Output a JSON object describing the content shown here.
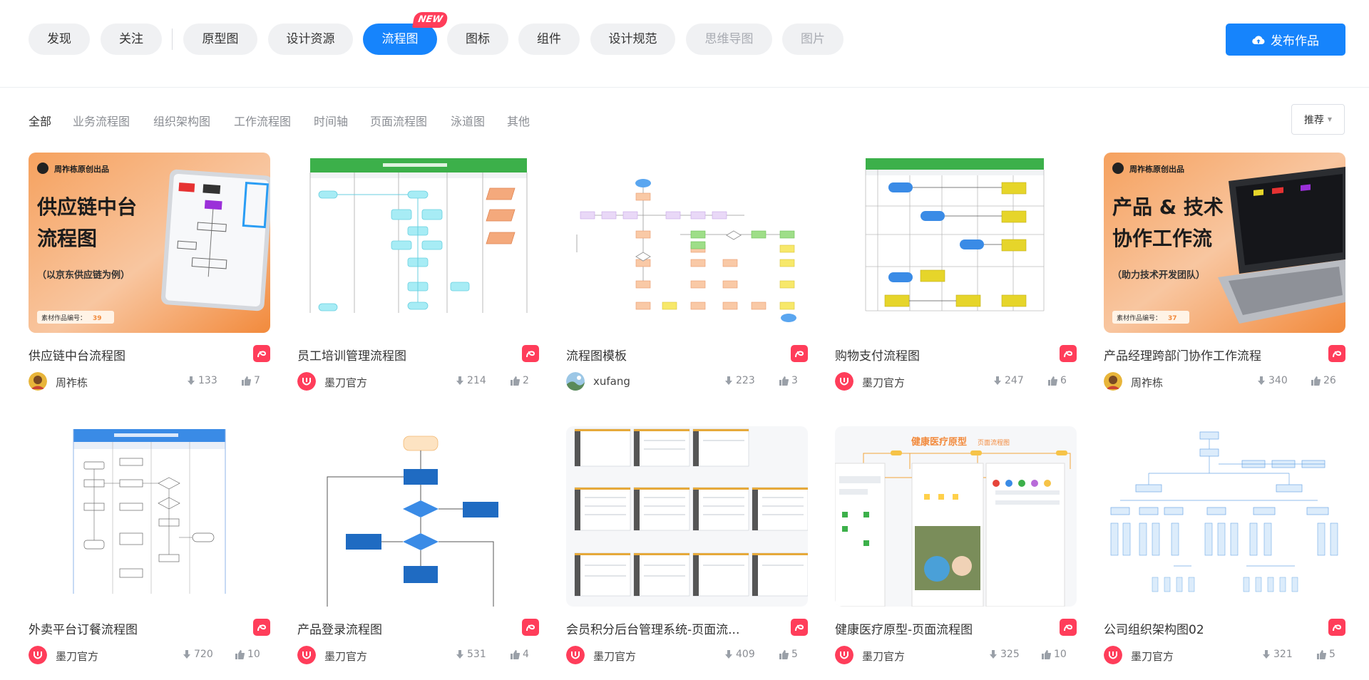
{
  "nav": {
    "pills": [
      "发现",
      "关注",
      "原型图",
      "设计资源",
      "流程图",
      "图标",
      "组件",
      "设计规范",
      "思维导图",
      "图片"
    ],
    "new_badge": "NEW",
    "publish_label": "发布作品"
  },
  "filters": [
    "全部",
    "业务流程图",
    "组织架构图",
    "工作流程图",
    "时间轴",
    "页面流程图",
    "泳道图",
    "其他"
  ],
  "sort_label": "推荐",
  "cards": [
    {
      "title": "供应链中台流程图",
      "author": "周祚栋",
      "downloads": "133",
      "likes": "7",
      "thumb": {
        "brand": "周祚栋原创出品",
        "line1": "供应链中台",
        "line2": "流程图",
        "sub": "（以京东供应链为例）",
        "code_label": "素材作品编号：",
        "code": "39"
      }
    },
    {
      "title": "员工培训管理流程图",
      "author": "墨刀官方",
      "downloads": "214",
      "likes": "2"
    },
    {
      "title": "流程图模板",
      "author": "xufang",
      "downloads": "223",
      "likes": "3"
    },
    {
      "title": "购物支付流程图",
      "author": "墨刀官方",
      "downloads": "247",
      "likes": "6"
    },
    {
      "title": "产品经理跨部门协作工作流程",
      "author": "周祚栋",
      "downloads": "340",
      "likes": "26",
      "thumb": {
        "brand": "周祚栋原创出品",
        "line1": "产品 & 技术",
        "line2": "协作工作流",
        "sub": "（助力技术开发团队）",
        "code_label": "素材作品编号：",
        "code": "37"
      }
    },
    {
      "title": "外卖平台订餐流程图",
      "author": "墨刀官方",
      "downloads": "720",
      "likes": "10"
    },
    {
      "title": "产品登录流程图",
      "author": "墨刀官方",
      "downloads": "531",
      "likes": "4"
    },
    {
      "title": "会员积分后台管理系统-页面流...",
      "author": "墨刀官方",
      "downloads": "409",
      "likes": "5"
    },
    {
      "title": "健康医疗原型-页面流程图",
      "author": "墨刀官方",
      "downloads": "325",
      "likes": "10",
      "thumb": {
        "heading": "健康医疗原型",
        "tag": "页面流程图"
      }
    },
    {
      "title": "公司组织架构图02",
      "author": "墨刀官方",
      "downloads": "321",
      "likes": "5"
    }
  ],
  "colors": {
    "accent": "#1684fc",
    "brand_red": "#ff3d5a",
    "new_badge": "#ff3d5a"
  },
  "icons": [
    "upload-cloud-icon",
    "download-icon",
    "thumbs-up-icon",
    "modao-brand-icon",
    "sort-caret-icon"
  ]
}
